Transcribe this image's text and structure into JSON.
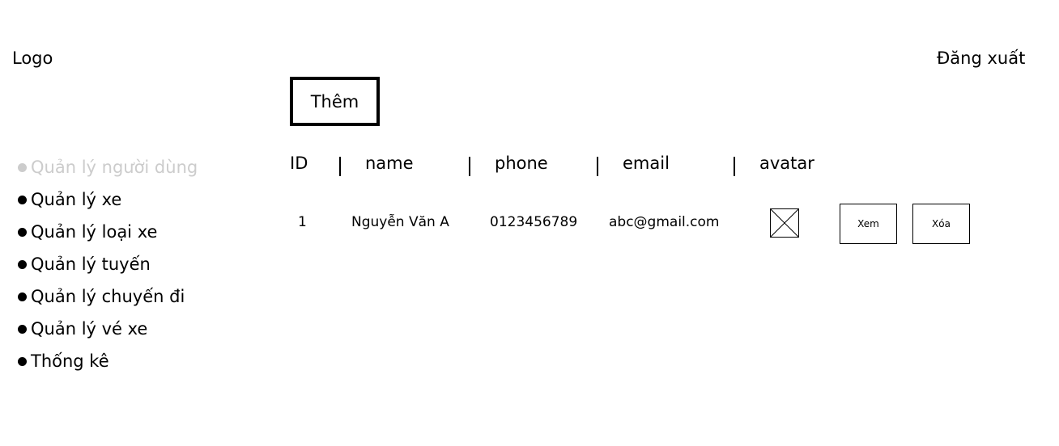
{
  "header": {
    "logo": "Logo",
    "logout": "Đăng xuất"
  },
  "toolbar": {
    "add_label": "Thêm"
  },
  "sidebar": {
    "items": [
      {
        "label": "Quản lý người dùng",
        "active": false
      },
      {
        "label": "Quản lý xe"
      },
      {
        "label": "Quản lý loại xe"
      },
      {
        "label": "Quản lý tuyến"
      },
      {
        "label": "Quản lý chuyến đi"
      },
      {
        "label": "Quản lý vé xe"
      },
      {
        "label": "Thống kê"
      }
    ]
  },
  "table": {
    "columns": [
      "ID",
      "name",
      "phone",
      "email",
      "avatar"
    ],
    "rows": [
      {
        "id": "1",
        "name": "Nguyễn Văn A",
        "phone": "0123456789",
        "email": "abc@gmail.com",
        "avatar_icon": "image-placeholder-icon",
        "view_label": "Xem",
        "delete_label": "Xóa"
      }
    ]
  },
  "colors": {
    "text": "#000000",
    "muted": "#cccccc",
    "background": "#ffffff"
  }
}
